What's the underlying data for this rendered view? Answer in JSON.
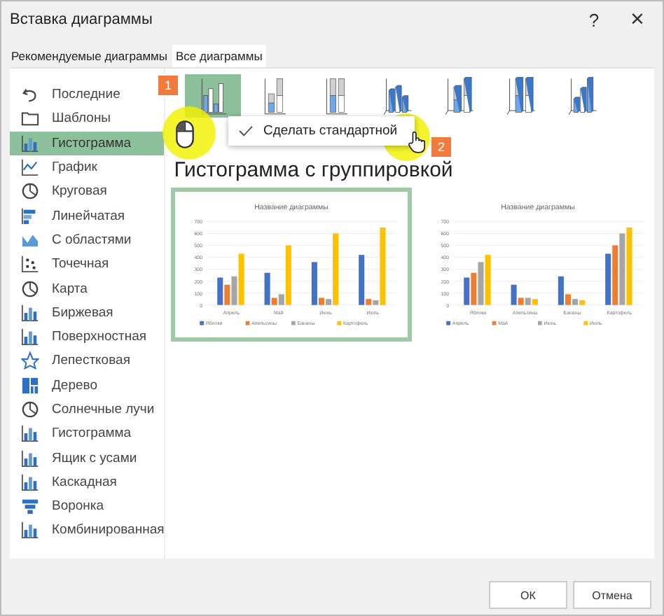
{
  "window": {
    "title": "Вставка диаграммы",
    "help": "?",
    "close": "×"
  },
  "tabs": [
    {
      "label": "Рекомендуемые диаграммы",
      "selected": false
    },
    {
      "label": "Все диаграммы",
      "selected": true
    }
  ],
  "sidebar": {
    "items": [
      {
        "label": "Последние",
        "selected": false
      },
      {
        "label": "Шаблоны",
        "selected": false
      },
      {
        "label": "Гистограмма",
        "selected": true
      },
      {
        "label": "График",
        "selected": false
      },
      {
        "label": "Круговая",
        "selected": false
      },
      {
        "label": "Линейчатая",
        "selected": false
      },
      {
        "label": "С областями",
        "selected": false
      },
      {
        "label": "Точечная",
        "selected": false
      },
      {
        "label": "Карта",
        "selected": false
      },
      {
        "label": "Биржевая",
        "selected": false
      },
      {
        "label": "Поверхностная",
        "selected": false
      },
      {
        "label": "Лепестковая",
        "selected": false
      },
      {
        "label": "Дерево",
        "selected": false
      },
      {
        "label": "Солнечные лучи",
        "selected": false
      },
      {
        "label": "Гистограмма",
        "selected": false
      },
      {
        "label": "Ящик с усами",
        "selected": false
      },
      {
        "label": "Каскадная",
        "selected": false
      },
      {
        "label": "Воронка",
        "selected": false
      },
      {
        "label": "Комбинированная",
        "selected": false
      }
    ]
  },
  "subtypes": [
    {
      "kind": "clustered",
      "selected": true
    },
    {
      "kind": "stacked",
      "selected": false
    },
    {
      "kind": "stacked100",
      "selected": false
    },
    {
      "kind": "clustered3d",
      "selected": false
    },
    {
      "kind": "stacked3d",
      "selected": false
    },
    {
      "kind": "stacked100_3d",
      "selected": false
    },
    {
      "kind": "column3d",
      "selected": false
    }
  ],
  "context_menu": {
    "items": [
      {
        "label": "Сделать стандартной",
        "checked": true
      }
    ]
  },
  "annotations": [
    {
      "label": "1"
    },
    {
      "label": "2"
    }
  ],
  "heading": "Гистограмма с группировкой",
  "previews": [
    {
      "selected": true,
      "chart_data": {
        "type": "bar",
        "title": "Название диаграммы",
        "grid": true,
        "legend": "bottom",
        "categories": [
          "Апрель",
          "Май",
          "Июнь",
          "Июль"
        ],
        "yticks": [
          0,
          100,
          200,
          300,
          400,
          500,
          600,
          700
        ],
        "ylim": [
          0,
          700
        ],
        "series": [
          {
            "name": "Яблоки",
            "color": "#4472c4",
            "values": [
              230,
              270,
              360,
              420
            ]
          },
          {
            "name": "Апельсины",
            "color": "#ed7d31",
            "values": [
              170,
              60,
              60,
              50
            ]
          },
          {
            "name": "Бананы",
            "color": "#a5a5a5",
            "values": [
              240,
              90,
              50,
              40
            ]
          },
          {
            "name": "Картофель",
            "color": "#ffc000",
            "values": [
              430,
              500,
              600,
              650
            ]
          }
        ]
      }
    },
    {
      "selected": false,
      "chart_data": {
        "type": "bar",
        "title": "Название диаграммы",
        "grid": true,
        "legend": "bottom",
        "categories": [
          "Яблоки",
          "Апельсины",
          "Бананы",
          "Картофель"
        ],
        "yticks": [
          0,
          100,
          200,
          300,
          400,
          500,
          600,
          700
        ],
        "ylim": [
          0,
          700
        ],
        "series": [
          {
            "name": "Апрель",
            "color": "#4472c4",
            "values": [
              230,
              170,
              240,
              430
            ]
          },
          {
            "name": "Май",
            "color": "#ed7d31",
            "values": [
              270,
              60,
              90,
              500
            ]
          },
          {
            "name": "Июнь",
            "color": "#a5a5a5",
            "values": [
              360,
              60,
              50,
              600
            ]
          },
          {
            "name": "Июль",
            "color": "#ffc000",
            "values": [
              420,
              50,
              40,
              650
            ]
          }
        ]
      }
    }
  ],
  "buttons": [
    {
      "label": "ОК"
    },
    {
      "label": "Отмена"
    }
  ]
}
